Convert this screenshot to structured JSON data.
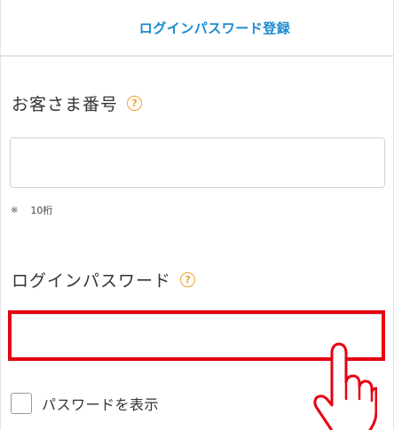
{
  "header": {
    "title": "ログインパスワード登録"
  },
  "customer_number": {
    "label": "お客さま番号",
    "help_icon": "question-circle-icon",
    "value": "",
    "placeholder": "",
    "note_mark": "※",
    "note": "10桁"
  },
  "login_password": {
    "label": "ログインパスワード",
    "help_icon": "question-circle-icon",
    "value": "",
    "placeholder": ""
  },
  "show_password": {
    "label": "パスワードを表示",
    "checked": false
  },
  "colors": {
    "header_title": "#1a8bd0",
    "help_icon": "#f0a030",
    "highlight": "#e60012"
  },
  "pointer_icon": "pointing-hand-icon"
}
